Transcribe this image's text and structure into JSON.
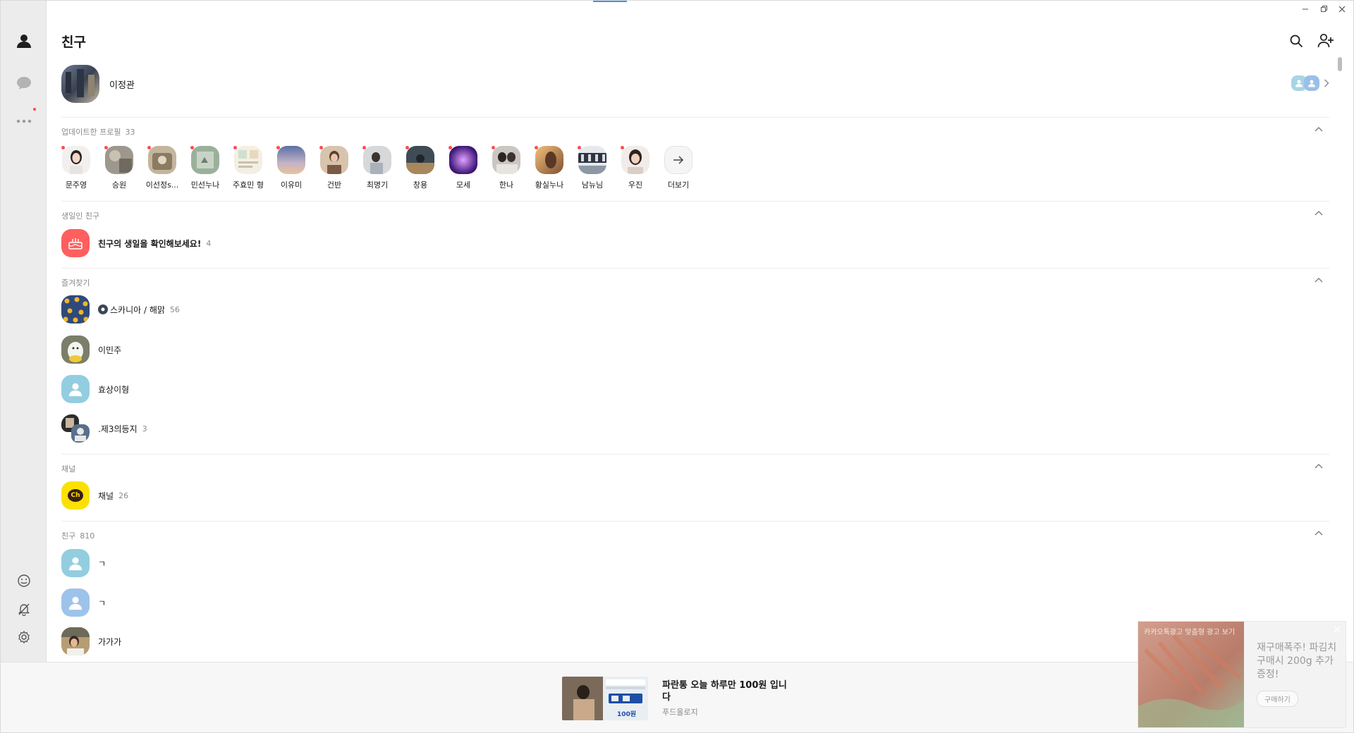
{
  "app": {
    "accent": "#4a90e2",
    "alert_dot": "#ff4b4b"
  },
  "header": {
    "title": "친구"
  },
  "me": {
    "name": "이정관"
  },
  "updated_profiles": {
    "title": "업데이트한 프로필",
    "count": "33",
    "items": [
      {
        "label": "문주영"
      },
      {
        "label": "승원"
      },
      {
        "label": "이선정s..."
      },
      {
        "label": "민선누나"
      },
      {
        "label": "주효민 형"
      },
      {
        "label": "이유미"
      },
      {
        "label": "건반"
      },
      {
        "label": "최명기"
      },
      {
        "label": "창용"
      },
      {
        "label": "모세"
      },
      {
        "label": "한나"
      },
      {
        "label": "황실누나"
      },
      {
        "label": "남뉴님"
      },
      {
        "label": "우진"
      }
    ],
    "more_label": "더보기"
  },
  "birthday": {
    "title": "생일인 친구",
    "row_label": "친구의 생일을 확인해보세요!",
    "row_count": "4"
  },
  "favorites": {
    "title": "즐겨찾기",
    "items": [
      {
        "name": "스카니아 / 해맑",
        "count": "56"
      },
      {
        "name": "이민주",
        "count": ""
      },
      {
        "name": "효상이형",
        "count": ""
      },
      {
        "name": ".제3의등지",
        "count": "3"
      }
    ]
  },
  "channel": {
    "title": "채널",
    "icon_text": "Ch",
    "row_label": "채널",
    "row_count": "26"
  },
  "friends": {
    "title": "친구",
    "count": "810",
    "items": [
      {
        "name": "ㄱ"
      },
      {
        "name": "ㄱ"
      },
      {
        "name": "가가가"
      }
    ]
  },
  "ad": {
    "title": "파란통 오늘 하루만 100원 입니다",
    "advertiser": "푸드올로지",
    "thumb_text": "100원"
  },
  "promo": {
    "badge": "카카오톡광고 맞춤형 광고 보기",
    "text": "재구매폭주! 파김치구매시 200g 추가증정!",
    "button": "구매하기"
  }
}
